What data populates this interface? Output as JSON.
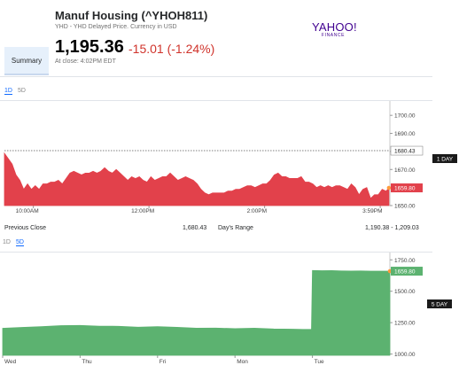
{
  "quote": {
    "name": "Manuf Housing (^YHOH811)",
    "subtitle": "YHD - YHD Delayed Price. Currency in USD",
    "price": "1,195.36",
    "change": "-15.01 (-1.24%)",
    "time": "At close: 4:02PM EDT"
  },
  "logo": {
    "main": "YAHOO!",
    "sub": "FINANCE"
  },
  "nav": {
    "summary_label": "Summary"
  },
  "intraday_tabs": [
    {
      "label": "1D",
      "active": true
    },
    {
      "label": "5D",
      "active": false
    }
  ],
  "fiveday_tabs": [
    {
      "label": "1D",
      "active": false
    },
    {
      "label": "5D",
      "active": true
    }
  ],
  "stats": {
    "prev_close_label": "Previous Close",
    "prev_close_value": "1,680.43",
    "day_range_label": "Day's Range",
    "day_range_value": "1,190.38 - 1,209.03"
  },
  "colors": {
    "down": "#e2414b",
    "up": "#5cb270",
    "accent": "#0f69ff",
    "marker": "#ff9a3c"
  },
  "chart_data": [
    {
      "type": "area",
      "range_label": "1 DAY",
      "ylim": [
        1650,
        1705
      ],
      "y_ticks": [
        1650,
        1660,
        1670,
        1680,
        1690,
        1700
      ],
      "y_tick_labels": [
        "1650.00",
        "1660.00",
        "1670.00",
        "1680.00",
        "1690.00",
        "1700.00"
      ],
      "x_tick_labels": [
        "10:00AM",
        "12:00PM",
        "2:00PM",
        "3:59PM"
      ],
      "x_ticks": [
        30,
        150,
        270,
        390
      ],
      "xlim": [
        0,
        400
      ],
      "reference": {
        "value": 1680.43,
        "label": "1680.43"
      },
      "last": {
        "value": 1659.8,
        "label": "1659.80"
      },
      "x": [
        0,
        4,
        8,
        12,
        16,
        20,
        24,
        28,
        32,
        36,
        40,
        44,
        48,
        52,
        56,
        60,
        64,
        68,
        72,
        76,
        80,
        84,
        88,
        92,
        96,
        100,
        104,
        108,
        112,
        116,
        120,
        124,
        128,
        132,
        136,
        140,
        144,
        148,
        152,
        156,
        160,
        164,
        168,
        172,
        176,
        180,
        184,
        188,
        192,
        196,
        200,
        204,
        208,
        212,
        216,
        220,
        224,
        228,
        232,
        236,
        240,
        244,
        248,
        252,
        256,
        260,
        264,
        268,
        272,
        276,
        280,
        284,
        288,
        292,
        296,
        300,
        304,
        308,
        312,
        316,
        320,
        324,
        328,
        332,
        336,
        340,
        344,
        348,
        352,
        356,
        360,
        364,
        368,
        372,
        376,
        380,
        384,
        388,
        392,
        396,
        399
      ],
      "y": [
        1679,
        1676,
        1673,
        1667,
        1664,
        1659,
        1662,
        1659,
        1661,
        1659,
        1662,
        1662,
        1663,
        1663,
        1664,
        1662,
        1665,
        1668,
        1669,
        1668,
        1667,
        1668,
        1668,
        1669,
        1668,
        1669,
        1671,
        1669,
        1668,
        1670,
        1668,
        1666,
        1664,
        1666,
        1665,
        1666,
        1664,
        1663,
        1666,
        1664,
        1665,
        1666,
        1666,
        1668,
        1666,
        1664,
        1665,
        1666,
        1665,
        1664,
        1662,
        1659,
        1657,
        1656,
        1657,
        1657,
        1657,
        1657,
        1658,
        1658,
        1659,
        1659,
        1660,
        1661,
        1661,
        1660,
        1661,
        1662,
        1662,
        1664,
        1667,
        1668,
        1666,
        1666,
        1665,
        1665,
        1665,
        1666,
        1663,
        1663,
        1662,
        1660,
        1661,
        1660,
        1661,
        1660,
        1661,
        1661,
        1660,
        1659,
        1662,
        1660,
        1656,
        1659,
        1660,
        1654,
        1656,
        1656,
        1659,
        1658,
        1659.8
      ]
    },
    {
      "type": "area",
      "range_label": "5 DAY",
      "ylim": [
        990,
        1780
      ],
      "y_ticks": [
        1000,
        1250,
        1500,
        1750
      ],
      "y_tick_labels": [
        "1000.00",
        "1250.00",
        "1500.00",
        "1750.00"
      ],
      "x_tick_labels": [
        "Wed",
        "Thu",
        "Fri",
        "Mon",
        "Tue"
      ],
      "x_ticks": [
        0,
        80,
        160,
        240,
        320
      ],
      "xlim": [
        0,
        400
      ],
      "last": {
        "value": 1659.8,
        "label": "1659.80"
      },
      "x": [
        0,
        20,
        40,
        60,
        80,
        100,
        120,
        140,
        160,
        180,
        200,
        220,
        240,
        260,
        280,
        300,
        310,
        319,
        320,
        330,
        340,
        350,
        360,
        370,
        380,
        390,
        400
      ],
      "y": [
        1205,
        1212,
        1218,
        1226,
        1228,
        1222,
        1221,
        1214,
        1218,
        1213,
        1206,
        1207,
        1202,
        1206,
        1200,
        1198,
        1196,
        1196,
        1665,
        1663,
        1664,
        1662,
        1661,
        1662,
        1660,
        1660,
        1659.8
      ]
    }
  ]
}
